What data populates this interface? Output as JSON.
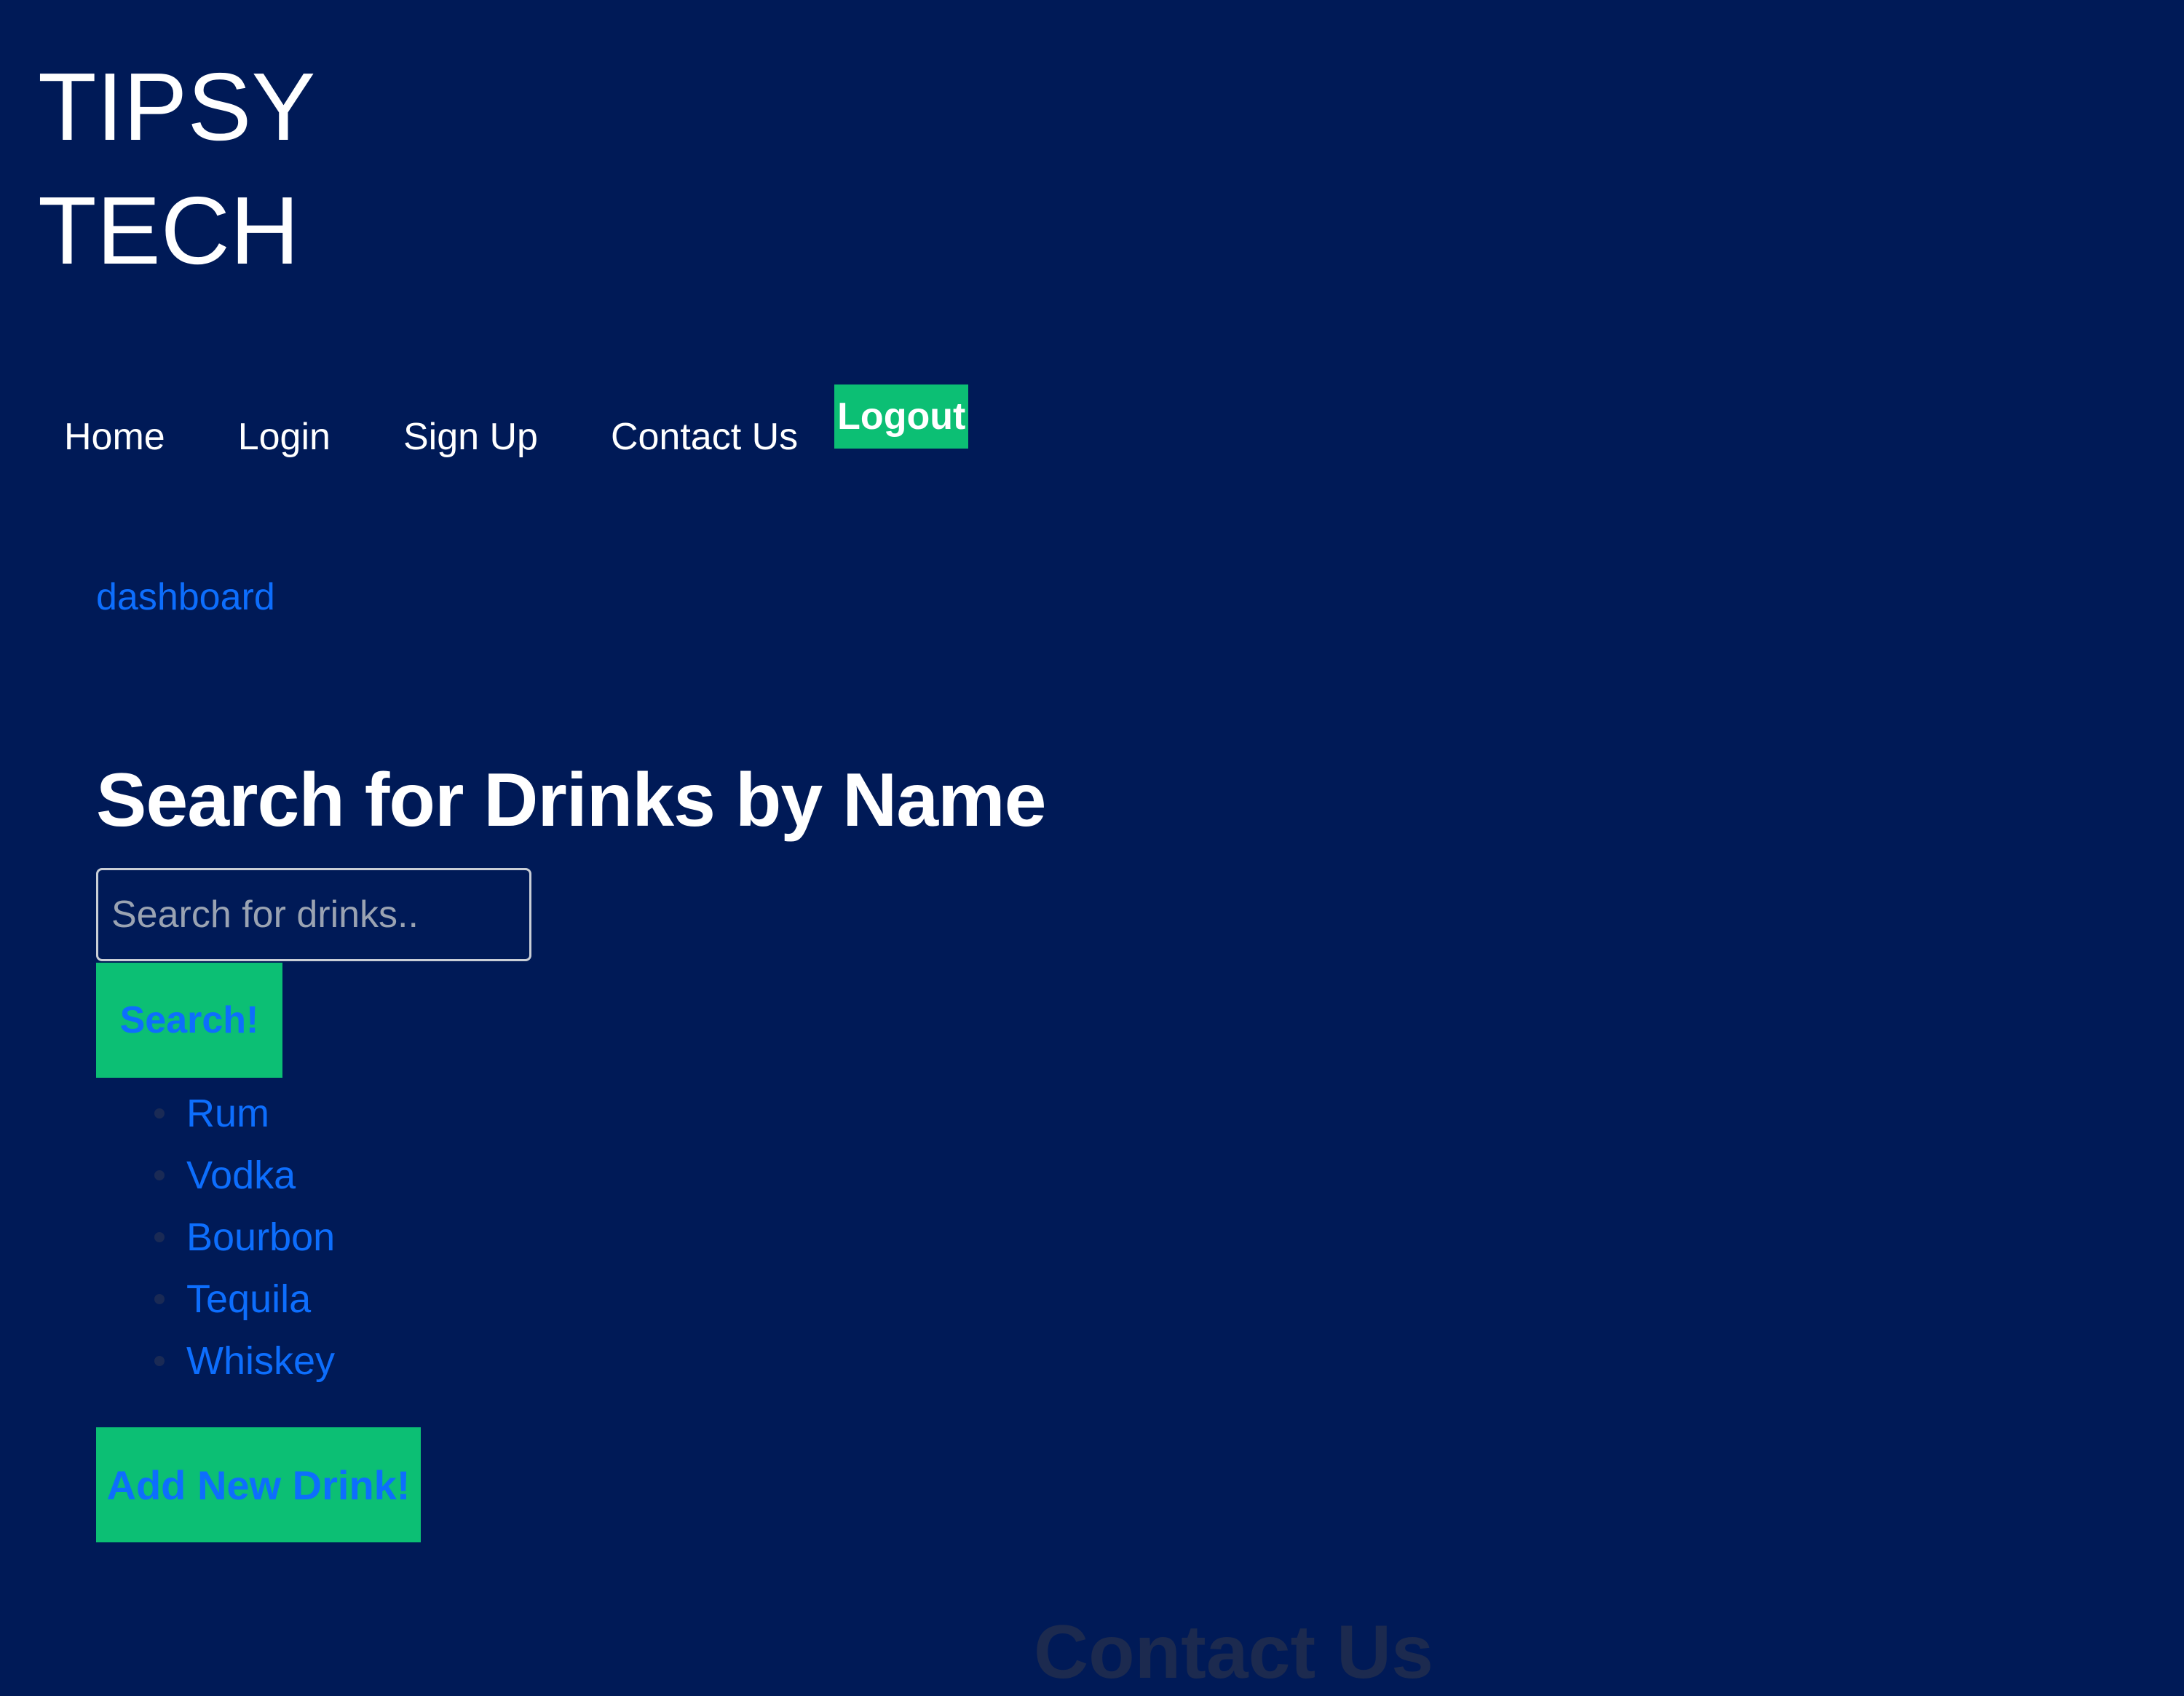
{
  "brand": {
    "line1": "TIPSY",
    "line2": "TECH"
  },
  "nav": {
    "items": [
      {
        "label": "Home"
      },
      {
        "label": "Login"
      },
      {
        "label": "Sign Up"
      },
      {
        "label": "Contact Us"
      }
    ],
    "logout_label": "Logout"
  },
  "dashboard_link": "dashboard",
  "search": {
    "heading": "Search for Drinks by Name",
    "placeholder": "Search for drinks..",
    "button_label": "Search!"
  },
  "drinks": [
    "Rum",
    "Vodka",
    "Bourbon",
    "Tequila",
    "Whiskey"
  ],
  "add_button_label": "Add New Drink!",
  "contact_heading": "Contact Us",
  "colors": {
    "background": "#001a57",
    "accent_green": "#0cbf74",
    "link_blue": "#0d6efd",
    "text_white": "#ffffff"
  }
}
